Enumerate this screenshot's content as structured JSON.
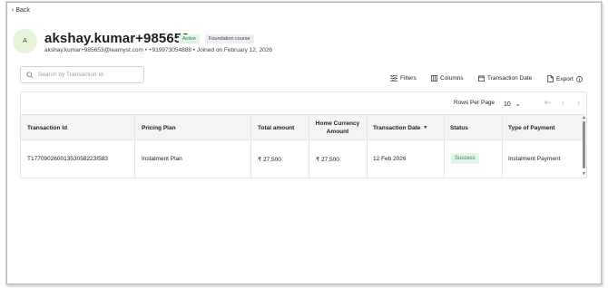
{
  "back": {
    "label": "Back"
  },
  "profile": {
    "avatar_initial": "A",
    "name": "akshay.kumar+985653",
    "status_badge": "Active",
    "course_badge": "Foundation course",
    "subline": "akshay.kumar+985653@learnyst.com • +919973054888 • Joined on February 12, 2026"
  },
  "search": {
    "placeholder": "Search by Transaction Id"
  },
  "toolbar": {
    "filters_label": "Filters",
    "columns_label": "Columns",
    "date_label": "Transaction Date",
    "export_label": "Export"
  },
  "pagination": {
    "rows_per_page_label": "Rows Per Page",
    "rows_per_page_value": "10"
  },
  "table": {
    "columns": [
      "Transaction Id",
      "Pricing Plan",
      "Total amount",
      "Home Currency Amount",
      "Transaction Date",
      "Status",
      "Type of Payment"
    ],
    "rows": [
      {
        "transaction_id": "T17709026001353058223I583",
        "pricing_plan": "Instalment Plan",
        "total_amount": "₹ 27,500",
        "home_currency_amount": "₹ 27,500",
        "transaction_date": "12 Feb 2026",
        "status": "Success",
        "type_of_payment": "Instalment Payment"
      }
    ]
  },
  "colors": {
    "success_bg": "#e2f5e9",
    "success_text": "#2f8a4c",
    "avatar_bg": "#e6f4d9",
    "header_bg": "#f3f4f6"
  }
}
